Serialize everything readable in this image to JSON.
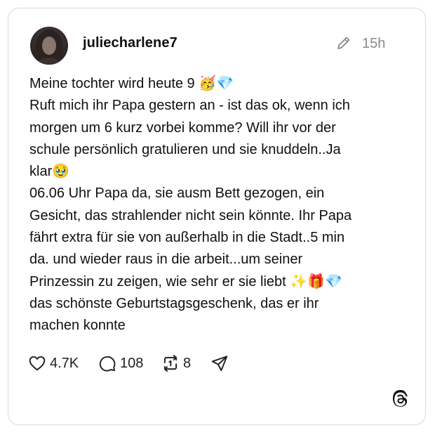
{
  "post": {
    "username": "juliecharlene7",
    "time": "15h",
    "lines": [
      "Meine tochter wird heute 9 🥳💎",
      "Ruft mich ihr Papa gestern an - ist das ok, wenn ich",
      "morgen um 6 kurz vorbei komme? Will ihr vor der",
      "schule persönlich gratulieren und sie knuddeln..Ja",
      "klar🥹",
      "06.06 Uhr Papa da, sie ausm Bett gezogen, ein",
      "Gesicht, das strahlender nicht sein könnte. Ihr Papa",
      "fährt extra für sie von außerhalb in die Stadt..5 min",
      "da. und wieder raus in die arbeit...um seiner",
      "Prinzessin zu zeigen, wie sehr er sie liebt ✨🎁💎",
      "das schönste Geburtstagsgeschenk, das er ihr",
      "machen konnte"
    ]
  },
  "actions": {
    "likes": "4.7K",
    "replies": "108",
    "reposts": "8"
  },
  "icons": {
    "edit": "pencil-icon",
    "like": "heart-icon",
    "reply": "comment-icon",
    "repost": "repost-icon",
    "share": "send-icon",
    "brand": "threads-logo-icon"
  }
}
